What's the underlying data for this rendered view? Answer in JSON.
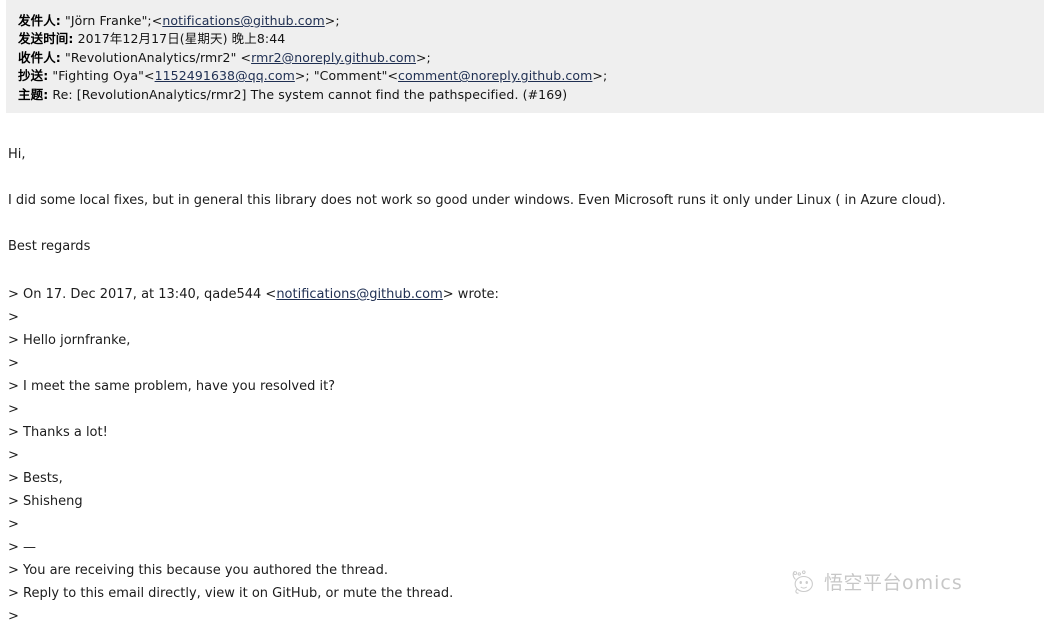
{
  "header": {
    "rows": [
      {
        "label": "发件人:",
        "parts": [
          {
            "type": "text",
            "text": " \"Jörn Franke\";<"
          },
          {
            "type": "link",
            "text": "notifications@github.com"
          },
          {
            "type": "text",
            "text": ">;"
          }
        ]
      },
      {
        "label": "发送时间:",
        "parts": [
          {
            "type": "text",
            "text": " 2017年12月17日(星期天) 晚上8:44"
          }
        ]
      },
      {
        "label": "收件人:",
        "parts": [
          {
            "type": "text",
            "text": " \"RevolutionAnalytics/rmr2\" <"
          },
          {
            "type": "link",
            "text": "rmr2@noreply.github.com"
          },
          {
            "type": "text",
            "text": ">;"
          }
        ]
      },
      {
        "label": "抄送:",
        "parts": [
          {
            "type": "text",
            "text": " \"Fighting Oya\"<"
          },
          {
            "type": "link",
            "text": "1152491638@qq.com"
          },
          {
            "type": "text",
            "text": ">; \"Comment\"<"
          },
          {
            "type": "link",
            "text": "comment@noreply.github.com"
          },
          {
            "type": "text",
            "text": ">;"
          }
        ]
      },
      {
        "label": "主题:",
        "parts": [
          {
            "type": "text",
            "text": " Re: [RevolutionAnalytics/rmr2] The system cannot find the pathspecified. (#169)"
          }
        ]
      }
    ]
  },
  "body": {
    "lines": [
      "Hi,",
      "",
      "I did some local fixes, but in general this library does not work so good under windows. Even Microsoft runs it only under Linux ( in Azure cloud).",
      "",
      "Best regards"
    ]
  },
  "quote": {
    "lines": [
      {
        "parts": [
          {
            "type": "text",
            "text": "> On 17. Dec 2017, at 13:40, qade544 <"
          },
          {
            "type": "link",
            "text": "notifications@github.com"
          },
          {
            "type": "text",
            "text": "> wrote:"
          }
        ]
      },
      {
        "parts": [
          {
            "type": "text",
            "text": ">"
          }
        ]
      },
      {
        "parts": [
          {
            "type": "text",
            "text": "> Hello jornfranke,"
          }
        ]
      },
      {
        "parts": [
          {
            "type": "text",
            "text": ">"
          }
        ]
      },
      {
        "parts": [
          {
            "type": "text",
            "text": "> I meet the same problem, have you resolved it?"
          }
        ]
      },
      {
        "parts": [
          {
            "type": "text",
            "text": ">"
          }
        ]
      },
      {
        "parts": [
          {
            "type": "text",
            "text": "> Thanks a lot!"
          }
        ]
      },
      {
        "parts": [
          {
            "type": "text",
            "text": ">"
          }
        ]
      },
      {
        "parts": [
          {
            "type": "text",
            "text": "> Bests,"
          }
        ]
      },
      {
        "parts": [
          {
            "type": "text",
            "text": "> Shisheng"
          }
        ]
      },
      {
        "parts": [
          {
            "type": "text",
            "text": ">"
          }
        ]
      },
      {
        "parts": [
          {
            "type": "text",
            "text": "> —"
          }
        ]
      },
      {
        "parts": [
          {
            "type": "text",
            "text": "> You are receiving this because you authored the thread."
          }
        ]
      },
      {
        "parts": [
          {
            "type": "text",
            "text": "> Reply to this email directly, view it on GitHub, or mute the thread."
          }
        ]
      },
      {
        "parts": [
          {
            "type": "text",
            "text": ">"
          }
        ]
      }
    ]
  },
  "watermark": {
    "logo_icon": "wukong-monkey-logo-icon",
    "text_cjk": "悟空平台",
    "text_latin": "omics"
  },
  "colors": {
    "header_background": "#efefef",
    "page_background": "#ffffff",
    "link": "#1f2f52",
    "text": "#1c1c1c"
  }
}
